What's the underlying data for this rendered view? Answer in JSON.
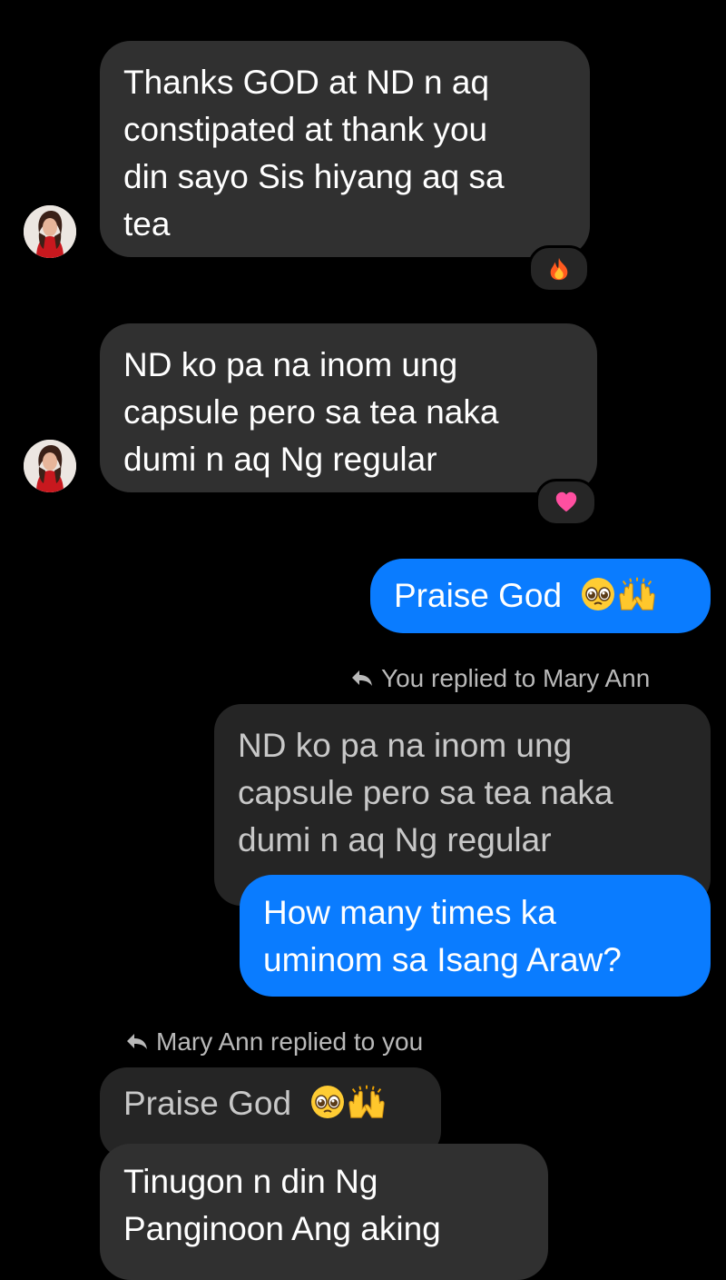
{
  "conversation": {
    "msg1": {
      "lines": [
        "Thanks GOD at ND n aq",
        "constipated at thank you",
        "din sayo Sis hiyang aq sa",
        "tea"
      ],
      "reaction": "fire-emoji"
    },
    "msg2": {
      "lines": [
        "ND ko pa na inom ung",
        "capsule  pero sa tea naka",
        "dumi n aq Ng regular"
      ],
      "reaction": "pink-heart-emoji"
    },
    "msg3": {
      "text": "Praise God",
      "emojis": [
        "pleading-face-emoji",
        "raising-hands-emoji"
      ]
    },
    "reply1": {
      "label": "You replied to Mary Ann",
      "quoted_lines": [
        "ND ko pa na inom ung",
        "capsule  pero sa tea naka",
        "dumi n aq Ng regular"
      ],
      "lines": [
        "How many times ka",
        "uminom sa Isang Araw?"
      ]
    },
    "reply2": {
      "label": "Mary Ann replied to you",
      "quoted_text": "Praise God",
      "quoted_emojis": [
        "pleading-face-emoji",
        "raising-hands-emoji"
      ],
      "lines": [
        "Tinugon n din Ng",
        "Panginoon Ang aking"
      ]
    }
  },
  "colors": {
    "background": "#000000",
    "received_bubble": "#303030",
    "sent_bubble": "#0a7cff",
    "quoted_bubble": "#252525",
    "reply_label": "#b9b9b9"
  }
}
